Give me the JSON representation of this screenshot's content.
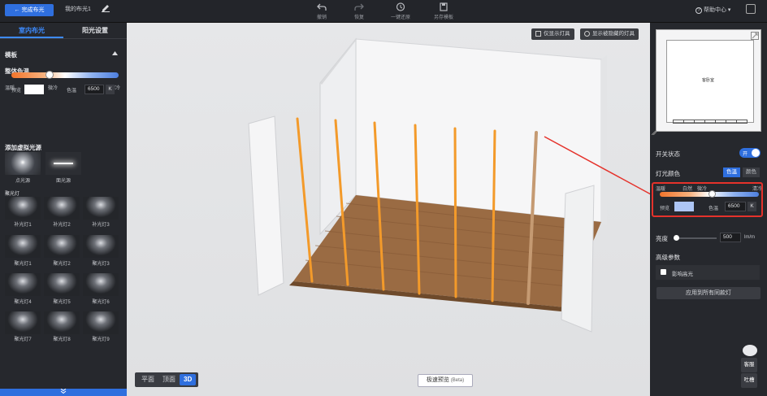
{
  "topbar": {
    "finish_label": "← 完成布光",
    "scheme_name": "我的布光1",
    "tools": [
      {
        "label": "撤销",
        "icon": "undo-icon"
      },
      {
        "label": "恢复",
        "icon": "redo-icon"
      },
      {
        "label": "一键还原",
        "icon": "reset-icon"
      },
      {
        "label": "另存模板",
        "icon": "save-template-icon"
      }
    ],
    "help_label": "帮助中心 ▾"
  },
  "left": {
    "tabs": [
      "室内布光",
      "阳光设置"
    ],
    "template_label": "模板",
    "color_temp_title": "整体色温",
    "scale_labels": [
      "温暖",
      "自然",
      "微冷",
      "清冷"
    ],
    "preview_label": "预览",
    "temp_label": "色温",
    "temp_value": "6500",
    "temp_unit": "K",
    "add_light_title": "添加虚拟光源",
    "basic_lights": [
      "点光源",
      "面光源"
    ],
    "spot_group_label": "聚光灯",
    "spots": [
      "补光灯1",
      "补光灯2",
      "补光灯3",
      "聚光灯1",
      "聚光灯2",
      "聚光灯3",
      "聚光灯4",
      "聚光灯5",
      "聚光灯6",
      "聚光灯7",
      "聚光灯8",
      "聚光灯9"
    ]
  },
  "viewport": {
    "only_show_lights": "仅显示灯具",
    "show_hidden_lights": "显示被隐藏的灯具",
    "view_modes": [
      "平面",
      "顶面",
      "3D"
    ],
    "active_view": "3D",
    "preview_label": "极速预览",
    "preview_beta": "(Beta)",
    "room_label": "客卧室"
  },
  "right": {
    "switch_label": "开关状态",
    "switch_state": "开",
    "light_color_label": "灯光颜色",
    "color_modes": [
      "色温",
      "颜色"
    ],
    "scale_labels": [
      "温暖",
      "白然",
      "微冷",
      "清冷"
    ],
    "preview_label": "预览",
    "temp_label": "色温",
    "temp_value": "6500",
    "temp_unit": "K",
    "brightness_label": "亮度",
    "brightness_value": "500",
    "brightness_unit": "lm/m",
    "advanced_label": "高级参数",
    "highlight_label": "影响高光",
    "apply_label": "应用到所有同款灯",
    "side_buttons": [
      "客服",
      "吐槽"
    ]
  },
  "colors": {
    "accent": "#2f6fde",
    "panel": "#26282d",
    "highlight_box": "#e5322b",
    "light_bar": "#f39a2a"
  }
}
